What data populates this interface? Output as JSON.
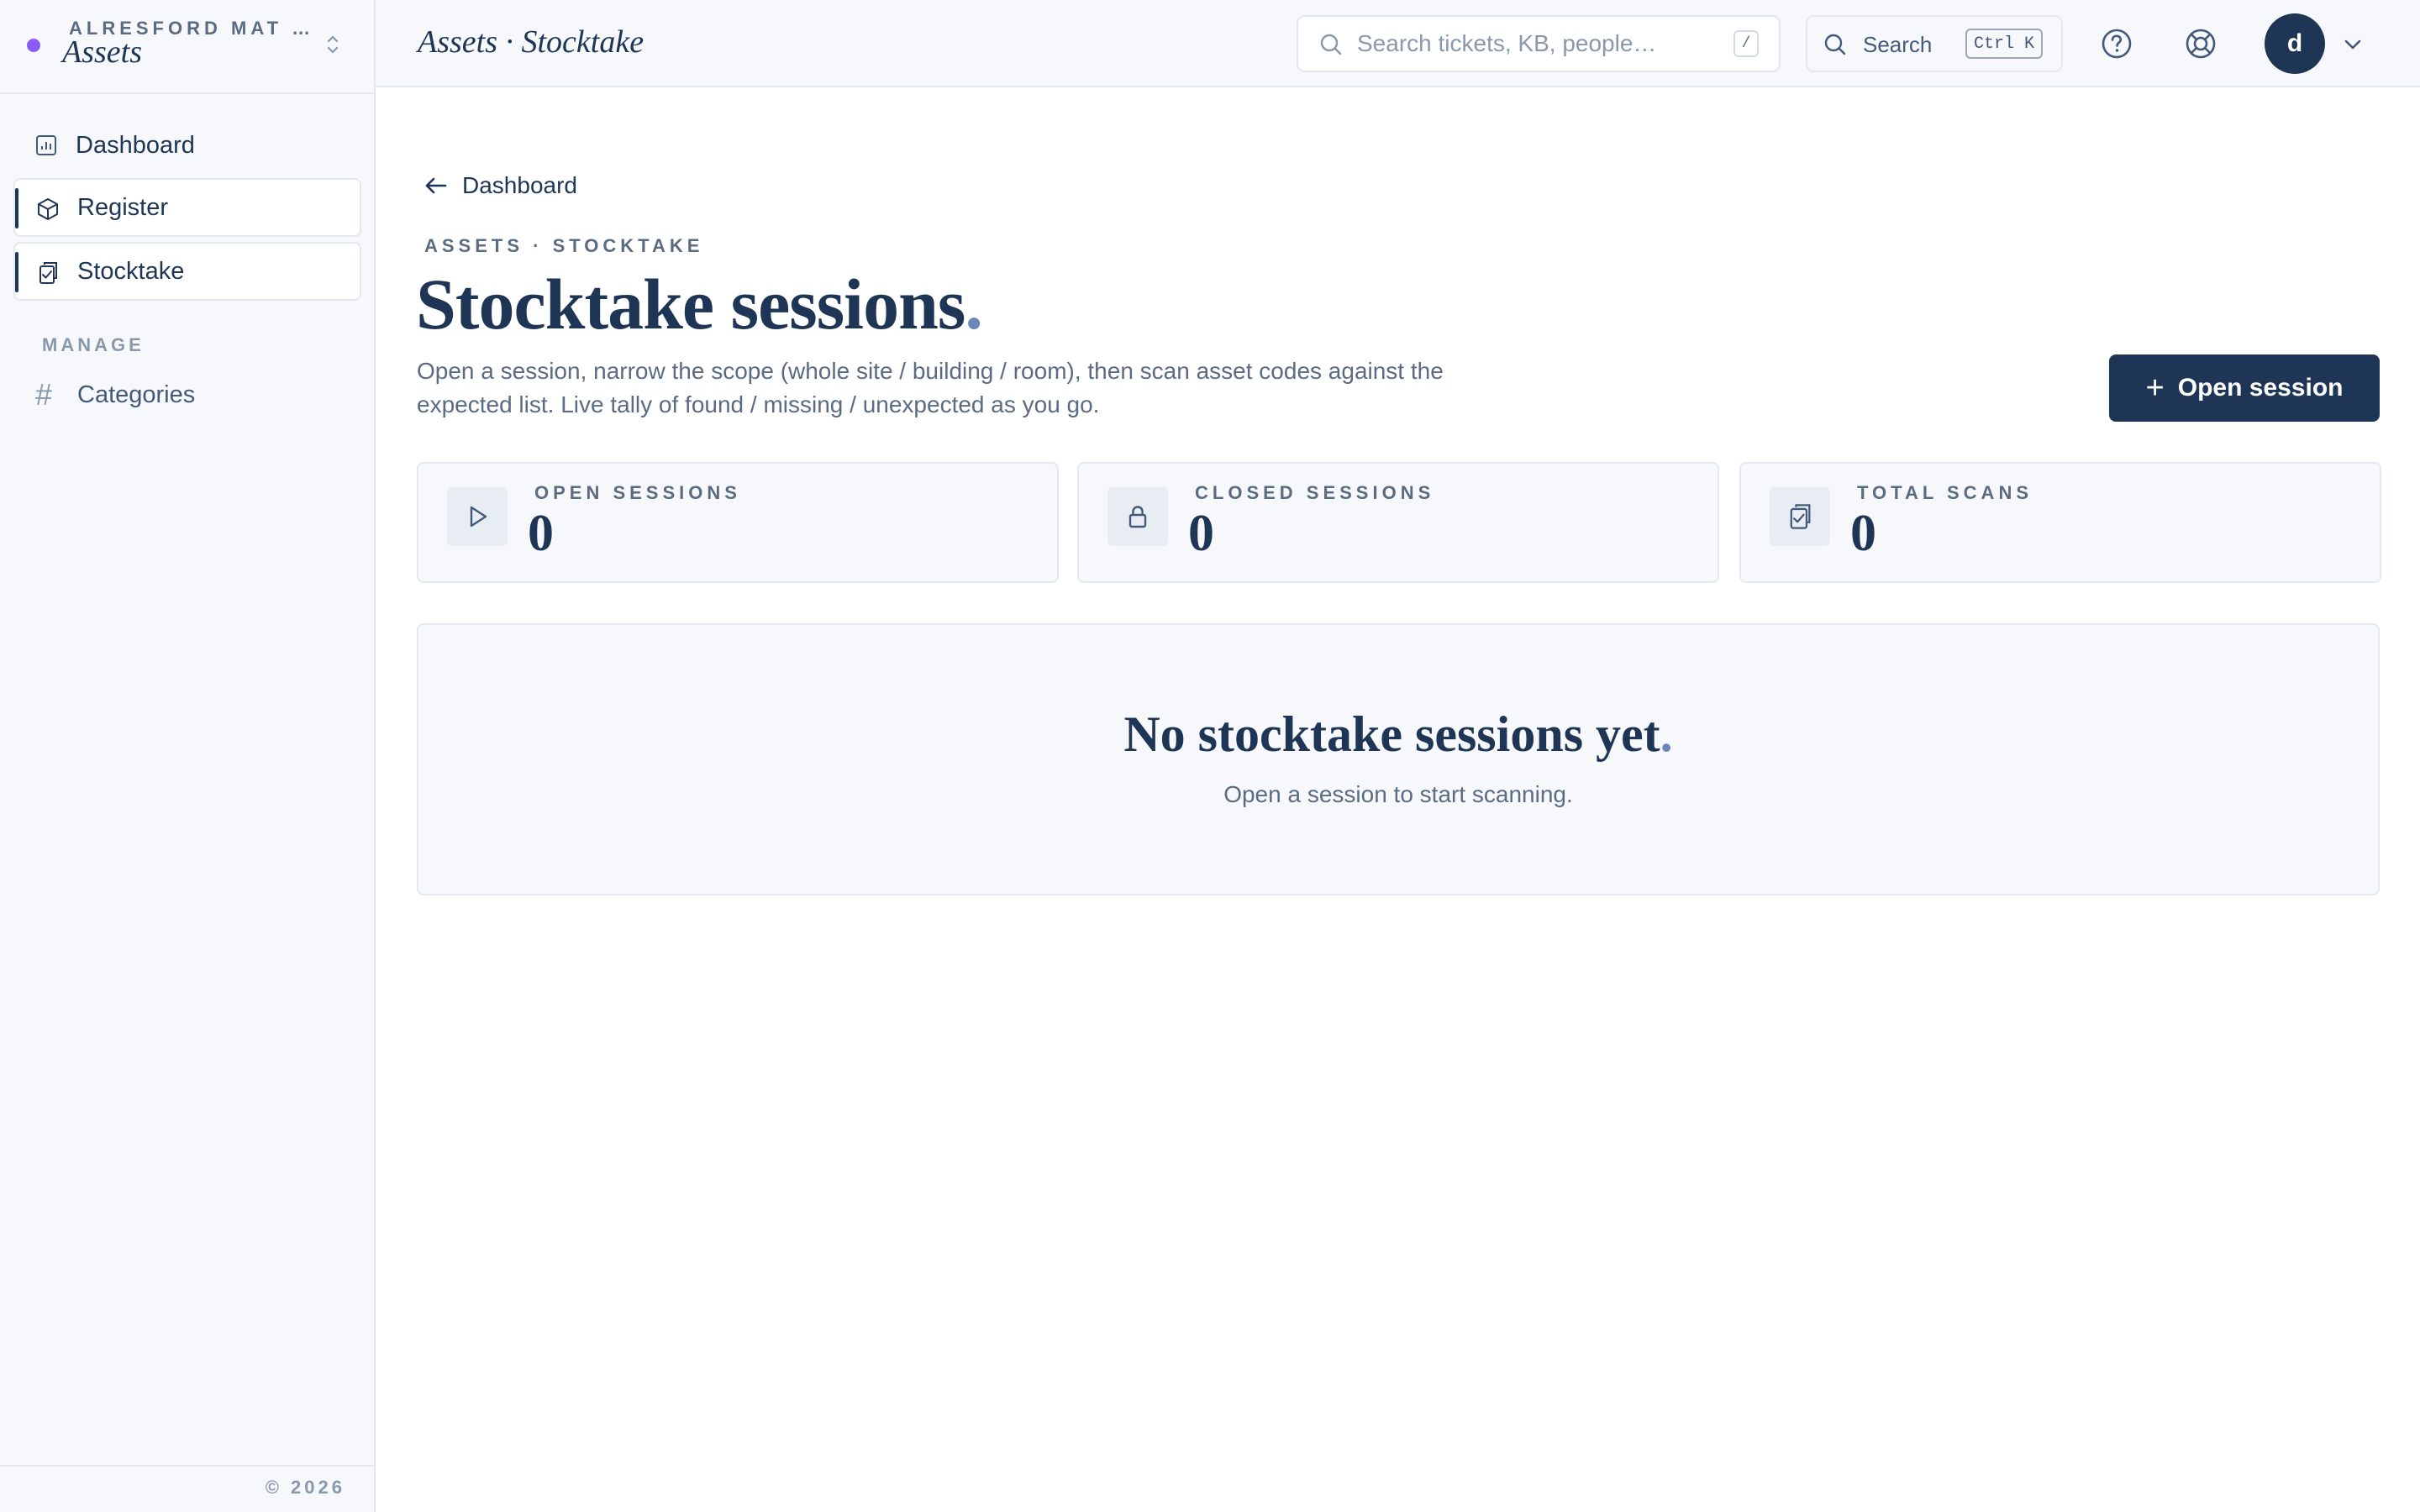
{
  "workspace": {
    "org": "ALRESFORD MAT …",
    "name": "Assets"
  },
  "sidebar": {
    "items": [
      {
        "label": "Dashboard",
        "icon": "chart-icon"
      },
      {
        "label": "Register",
        "icon": "box-icon"
      },
      {
        "label": "Stocktake",
        "icon": "clipboard-check-icon"
      }
    ],
    "section_label": "MANAGE",
    "manage_items": [
      {
        "label": "Categories",
        "icon": "hash-icon"
      }
    ],
    "footer": "© 2026"
  },
  "topbar": {
    "title": "Assets · Stocktake",
    "search_placeholder": "Search tickets, KB, people…",
    "search_shortcut": "/",
    "search_button_label": "Search",
    "search_button_shortcut": "Ctrl K",
    "avatar_initial": "d"
  },
  "page": {
    "back_label": "Dashboard",
    "eyebrow": "ASSETS · STOCKTAKE",
    "title": "Stocktake sessions",
    "title_accent": ".",
    "description": "Open a session, narrow the scope (whole site / building / room), then scan asset codes against the expected list. Live tally of found / missing / unexpected as you go.",
    "primary_action": "Open session"
  },
  "stats": [
    {
      "label": "OPEN SESSIONS",
      "value": "0",
      "icon": "play-icon"
    },
    {
      "label": "CLOSED SESSIONS",
      "value": "0",
      "icon": "lock-icon"
    },
    {
      "label": "TOTAL SCANS",
      "value": "0",
      "icon": "clipboard-check-icon"
    }
  ],
  "empty_state": {
    "title": "No stocktake sessions yet",
    "title_accent": ".",
    "subtitle": "Open a session to start scanning."
  },
  "colors": {
    "primary": "#1f3556",
    "accent_dot": "#8b5cf6",
    "muted_text": "#5b6b82",
    "border": "#e3e8ef",
    "surface": "#f6f8fb"
  }
}
